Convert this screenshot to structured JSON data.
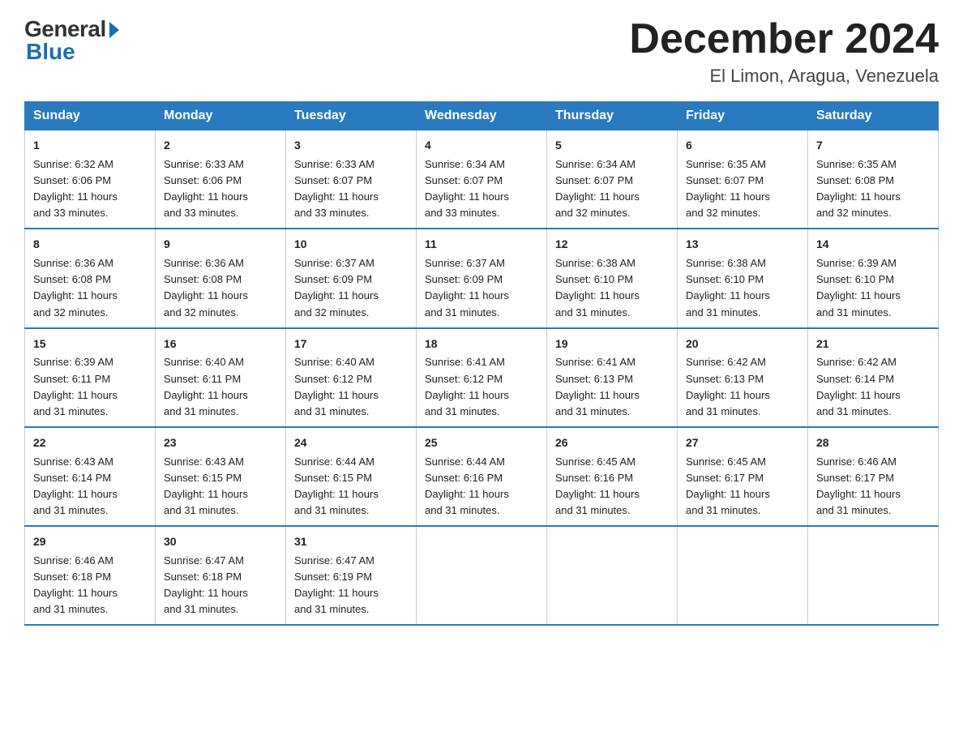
{
  "logo": {
    "general": "General",
    "blue": "Blue"
  },
  "title": "December 2024",
  "subtitle": "El Limon, Aragua, Venezuela",
  "days_header": [
    "Sunday",
    "Monday",
    "Tuesday",
    "Wednesday",
    "Thursday",
    "Friday",
    "Saturday"
  ],
  "weeks": [
    [
      {
        "day": "1",
        "sunrise": "6:32 AM",
        "sunset": "6:06 PM",
        "daylight": "11 hours and 33 minutes."
      },
      {
        "day": "2",
        "sunrise": "6:33 AM",
        "sunset": "6:06 PM",
        "daylight": "11 hours and 33 minutes."
      },
      {
        "day": "3",
        "sunrise": "6:33 AM",
        "sunset": "6:07 PM",
        "daylight": "11 hours and 33 minutes."
      },
      {
        "day": "4",
        "sunrise": "6:34 AM",
        "sunset": "6:07 PM",
        "daylight": "11 hours and 33 minutes."
      },
      {
        "day": "5",
        "sunrise": "6:34 AM",
        "sunset": "6:07 PM",
        "daylight": "11 hours and 32 minutes."
      },
      {
        "day": "6",
        "sunrise": "6:35 AM",
        "sunset": "6:07 PM",
        "daylight": "11 hours and 32 minutes."
      },
      {
        "day": "7",
        "sunrise": "6:35 AM",
        "sunset": "6:08 PM",
        "daylight": "11 hours and 32 minutes."
      }
    ],
    [
      {
        "day": "8",
        "sunrise": "6:36 AM",
        "sunset": "6:08 PM",
        "daylight": "11 hours and 32 minutes."
      },
      {
        "day": "9",
        "sunrise": "6:36 AM",
        "sunset": "6:08 PM",
        "daylight": "11 hours and 32 minutes."
      },
      {
        "day": "10",
        "sunrise": "6:37 AM",
        "sunset": "6:09 PM",
        "daylight": "11 hours and 32 minutes."
      },
      {
        "day": "11",
        "sunrise": "6:37 AM",
        "sunset": "6:09 PM",
        "daylight": "11 hours and 31 minutes."
      },
      {
        "day": "12",
        "sunrise": "6:38 AM",
        "sunset": "6:10 PM",
        "daylight": "11 hours and 31 minutes."
      },
      {
        "day": "13",
        "sunrise": "6:38 AM",
        "sunset": "6:10 PM",
        "daylight": "11 hours and 31 minutes."
      },
      {
        "day": "14",
        "sunrise": "6:39 AM",
        "sunset": "6:10 PM",
        "daylight": "11 hours and 31 minutes."
      }
    ],
    [
      {
        "day": "15",
        "sunrise": "6:39 AM",
        "sunset": "6:11 PM",
        "daylight": "11 hours and 31 minutes."
      },
      {
        "day": "16",
        "sunrise": "6:40 AM",
        "sunset": "6:11 PM",
        "daylight": "11 hours and 31 minutes."
      },
      {
        "day": "17",
        "sunrise": "6:40 AM",
        "sunset": "6:12 PM",
        "daylight": "11 hours and 31 minutes."
      },
      {
        "day": "18",
        "sunrise": "6:41 AM",
        "sunset": "6:12 PM",
        "daylight": "11 hours and 31 minutes."
      },
      {
        "day": "19",
        "sunrise": "6:41 AM",
        "sunset": "6:13 PM",
        "daylight": "11 hours and 31 minutes."
      },
      {
        "day": "20",
        "sunrise": "6:42 AM",
        "sunset": "6:13 PM",
        "daylight": "11 hours and 31 minutes."
      },
      {
        "day": "21",
        "sunrise": "6:42 AM",
        "sunset": "6:14 PM",
        "daylight": "11 hours and 31 minutes."
      }
    ],
    [
      {
        "day": "22",
        "sunrise": "6:43 AM",
        "sunset": "6:14 PM",
        "daylight": "11 hours and 31 minutes."
      },
      {
        "day": "23",
        "sunrise": "6:43 AM",
        "sunset": "6:15 PM",
        "daylight": "11 hours and 31 minutes."
      },
      {
        "day": "24",
        "sunrise": "6:44 AM",
        "sunset": "6:15 PM",
        "daylight": "11 hours and 31 minutes."
      },
      {
        "day": "25",
        "sunrise": "6:44 AM",
        "sunset": "6:16 PM",
        "daylight": "11 hours and 31 minutes."
      },
      {
        "day": "26",
        "sunrise": "6:45 AM",
        "sunset": "6:16 PM",
        "daylight": "11 hours and 31 minutes."
      },
      {
        "day": "27",
        "sunrise": "6:45 AM",
        "sunset": "6:17 PM",
        "daylight": "11 hours and 31 minutes."
      },
      {
        "day": "28",
        "sunrise": "6:46 AM",
        "sunset": "6:17 PM",
        "daylight": "11 hours and 31 minutes."
      }
    ],
    [
      {
        "day": "29",
        "sunrise": "6:46 AM",
        "sunset": "6:18 PM",
        "daylight": "11 hours and 31 minutes."
      },
      {
        "day": "30",
        "sunrise": "6:47 AM",
        "sunset": "6:18 PM",
        "daylight": "11 hours and 31 minutes."
      },
      {
        "day": "31",
        "sunrise": "6:47 AM",
        "sunset": "6:19 PM",
        "daylight": "11 hours and 31 minutes."
      },
      null,
      null,
      null,
      null
    ]
  ],
  "labels": {
    "sunrise": "Sunrise:",
    "sunset": "Sunset:",
    "daylight": "Daylight:"
  }
}
